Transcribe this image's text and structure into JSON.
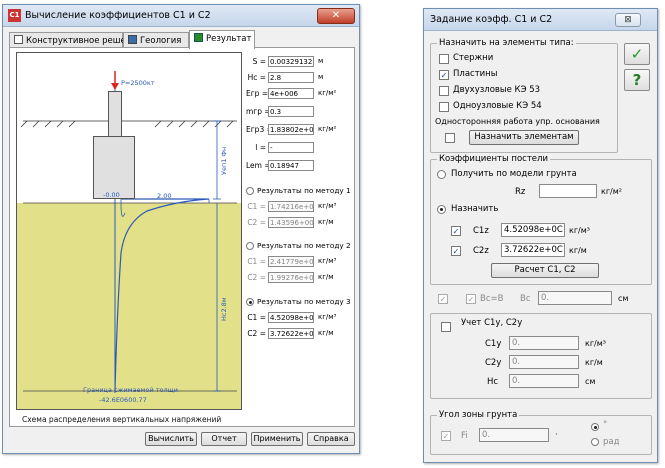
{
  "left_window": {
    "title": "Вычисление коэффициентов C1 и C2",
    "tabs": [
      {
        "label": "Конструктивное решение"
      },
      {
        "label": "Геология"
      },
      {
        "label": "Результат"
      }
    ],
    "drawing": {
      "label_top": "P=2500кт",
      "label_level": "-0.00",
      "label_mid": "2.00",
      "label_right1": "Уеп1 Фн",
      "label_right2": "Нс2.8м",
      "label_bottom1": "Граница сжимаемой толщи",
      "label_bottom2": "-42.6E0600.77",
      "caption": "Схема распределения вертикальных напряжений"
    },
    "fields": [
      {
        "label": "S =",
        "value": "0.00329132",
        "unit": "м"
      },
      {
        "label": "Hc =",
        "value": "2.8",
        "unit": "м"
      },
      {
        "label": "Егр =",
        "value": "4e+006",
        "unit": "кг/м²"
      },
      {
        "label": "mгр =",
        "value": "0.3",
        "unit": ""
      },
      {
        "label": "Егр3 =",
        "value": "1.83802e+0С",
        "unit": "кг/м²"
      },
      {
        "label": "l =",
        "value": "-",
        "unit": ""
      },
      {
        "label": "Lem =",
        "value": "0.18947",
        "unit": ""
      }
    ],
    "methods": [
      {
        "label": "Результаты по методу 1",
        "c1": "1.74216e+0С",
        "c2": "1.43596+008",
        "unit1": "кг/м³",
        "unit2": "кг/м",
        "selected": false
      },
      {
        "label": "Результаты по методу 2",
        "c1": "2.41779e+0С",
        "c2": "1.99276e+0С",
        "unit1": "кг/м³",
        "unit2": "кг/м",
        "selected": false
      },
      {
        "label": "Результаты по методу 3",
        "c1": "4.52098e+0С",
        "c2": "3.72622e+0С",
        "unit1": "кг/м³",
        "unit2": "кг/м",
        "selected": true
      }
    ],
    "c1_label": "C1 =",
    "c2_label": "C2 =",
    "buttons": {
      "calc": "Вычислить",
      "report": "Отчет",
      "apply": "Применить",
      "help": "Справка"
    }
  },
  "right_window": {
    "title": "Задание коэфф. C1 и C2",
    "close_symbol": "⊠",
    "group_types": {
      "title": "Назначить на элементы типа:",
      "items": [
        {
          "label": "Стержни",
          "checked": false
        },
        {
          "label": "Пластины",
          "checked": true
        },
        {
          "label": "Двухузловые КЭ 53",
          "checked": false
        },
        {
          "label": "Одноузловые КЭ 54",
          "checked": false
        }
      ],
      "one_side_label": "Односторонняя работа упр. основания",
      "assign_button": "Назначить элементам"
    },
    "ok_symbol": "✓",
    "help_symbol": "?",
    "group_coeffs": {
      "title": "Коэффициенты постели",
      "from_model_label": "Получить по модели грунта",
      "rz_label": "Rz",
      "rz_value": "",
      "rz_unit": "кг/м²",
      "assign_label": "Назначить",
      "c1z_label": "C1z",
      "c1z_value": "4.52098e+0С",
      "c1z_unit": "кг/м³",
      "c2z_label": "C2z",
      "c2z_value": "3.72622e+0С",
      "c2z_unit": "кг/м",
      "calc_button": "Расчет C1, C2"
    },
    "bc_row": {
      "bc_eq_label": "Bc=B",
      "bc_label": "Bc",
      "bc_value": "0.",
      "bc_unit": "см"
    },
    "group_c1y": {
      "title": "Учет C1y, C2y",
      "c1y_label": "C1y",
      "c1y_value": "0.",
      "c1y_unit": "кг/м³",
      "c2y_label": "C2y",
      "c2y_value": "0.",
      "c2y_unit": "кг/м",
      "hc_label": "Hc",
      "hc_value": "0.",
      "hc_unit": "см"
    },
    "group_angle": {
      "title": "Угол зоны грунта",
      "fi_label": "Fi",
      "fi_value": "0.",
      "deg_label": "°",
      "rad_label": "рад"
    }
  }
}
